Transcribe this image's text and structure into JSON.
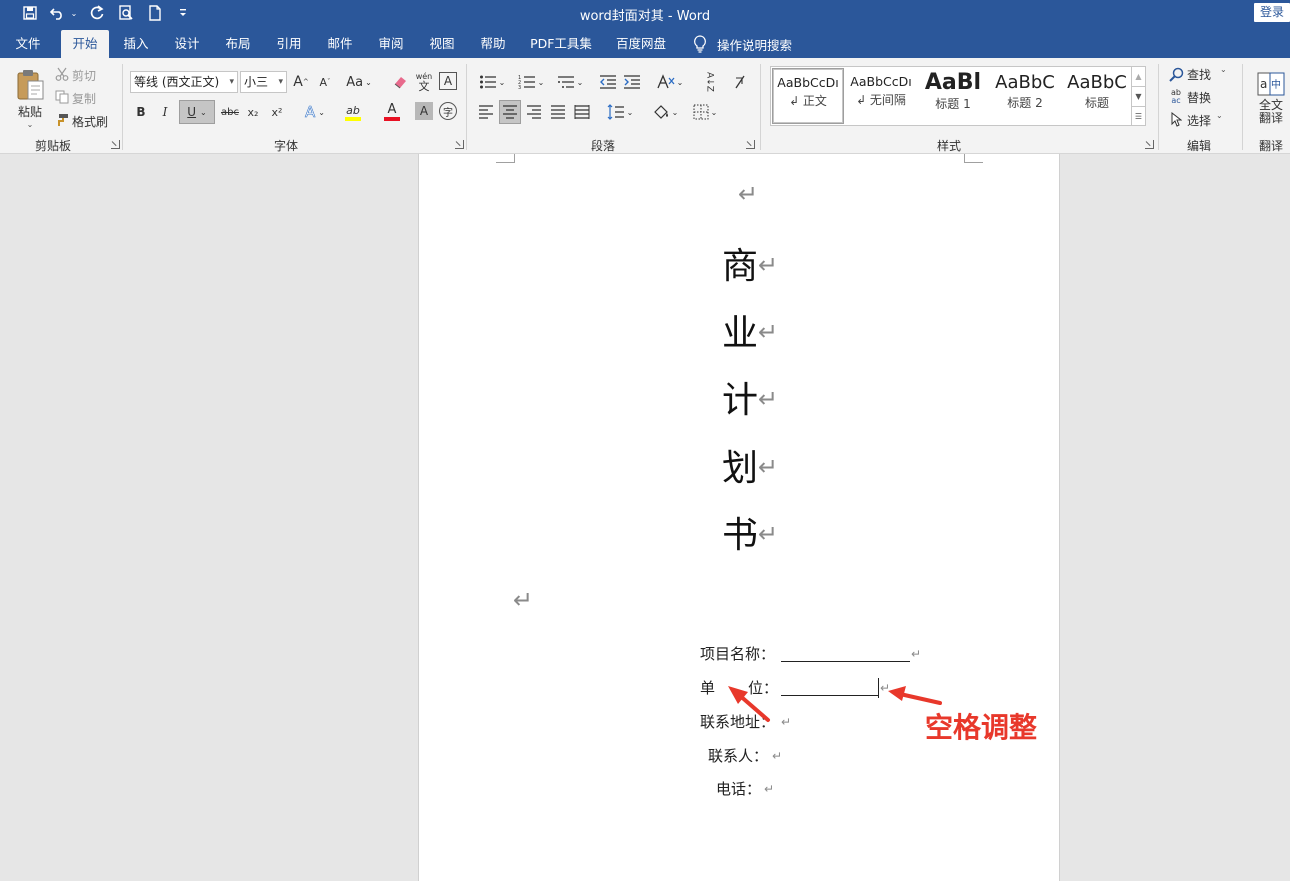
{
  "window": {
    "title": "word封面对其 - Word",
    "login_label": "登录"
  },
  "quick_access": [
    "save-icon",
    "undo-icon",
    "redo-icon",
    "print-preview-icon",
    "new-document-icon",
    "customize-icon"
  ],
  "tabs": [
    {
      "label": "文件",
      "active": false
    },
    {
      "label": "开始",
      "active": true
    },
    {
      "label": "插入",
      "active": false
    },
    {
      "label": "设计",
      "active": false
    },
    {
      "label": "布局",
      "active": false
    },
    {
      "label": "引用",
      "active": false
    },
    {
      "label": "邮件",
      "active": false
    },
    {
      "label": "审阅",
      "active": false
    },
    {
      "label": "视图",
      "active": false
    },
    {
      "label": "帮助",
      "active": false
    },
    {
      "label": "PDF工具集",
      "active": false
    },
    {
      "label": "百度网盘",
      "active": false
    }
  ],
  "tell_me": "操作说明搜索",
  "ribbon": {
    "clipboard": {
      "label": "剪贴板",
      "paste": "粘贴",
      "cut": "剪切",
      "copy": "复制",
      "format_painter": "格式刷"
    },
    "font": {
      "label": "字体",
      "font_name": "等线 (西文正文)",
      "font_size": "小三",
      "change_case": "Aa",
      "phonetic_top": "wén",
      "phonetic_bottom": "文",
      "enclose": "A",
      "bold": "B",
      "italic": "I",
      "underline": "U",
      "strikethrough": "abc",
      "subscript": "x₂",
      "superscript": "x²",
      "grow": "A",
      "shrink": "A",
      "effects": "A",
      "highlight": "ab",
      "color": "A",
      "shading": "A",
      "circled": "字",
      "highlight_color": "#ffff00",
      "font_color": "#e81123"
    },
    "paragraph": {
      "label": "段落",
      "sort": "A↓Z"
    },
    "styles": {
      "label": "样式",
      "items": [
        {
          "sample": "AaBbCcDı",
          "name": "↲ 正文",
          "selected": true
        },
        {
          "sample": "AaBbCcDı",
          "name": "↲ 无间隔",
          "selected": false
        },
        {
          "sample": "AaBl",
          "name": "标题 1",
          "selected": false
        },
        {
          "sample": "AaBbC",
          "name": "标题 2",
          "selected": false
        },
        {
          "sample": "AaBbC",
          "name": "标题",
          "selected": false
        }
      ]
    },
    "editing": {
      "label": "编辑",
      "find": "查找",
      "replace": "替换",
      "select": "选择"
    },
    "translate": {
      "label": "翻译",
      "button_line1": "全文",
      "button_line2": "翻译"
    }
  },
  "document": {
    "paragraph_mark": "↵",
    "title_chars": [
      "商",
      "业",
      "计",
      "划",
      "书"
    ],
    "fields": [
      {
        "label": "项目名称："
      },
      {
        "label": "单",
        "label2": "位："
      },
      {
        "label": "联系地址："
      },
      {
        "label": "联系人："
      },
      {
        "label": "电话："
      }
    ],
    "annotation": "空格调整",
    "annotation_color": "#e8382b"
  }
}
